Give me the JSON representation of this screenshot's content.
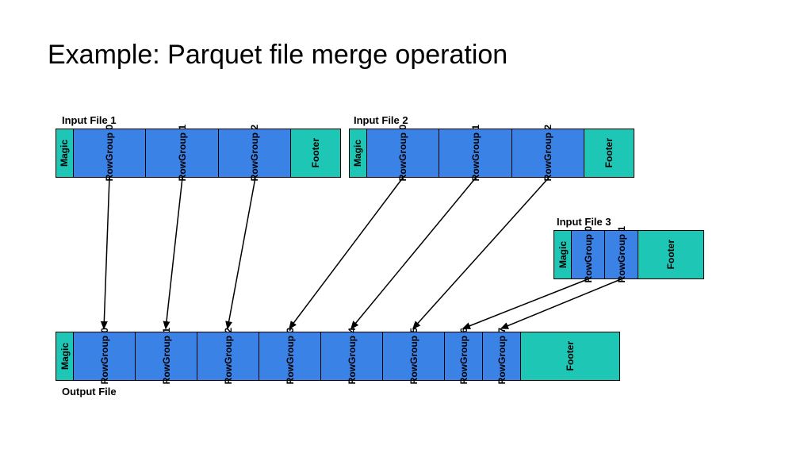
{
  "title": "Example: Parquet file merge operation",
  "labels": {
    "input1": "Input File 1",
    "input2": "Input File 2",
    "input3": "Input File 3",
    "output": "Output File"
  },
  "blocks": {
    "magic": "Magic",
    "footer": "Footer",
    "rg0": "RowGroup 0",
    "rg1": "RowGroup 1",
    "rg2": "RowGroup 2",
    "rg3": "RowGroup 3",
    "rg4": "RowGroup 4",
    "rg5": "RowGroup 5",
    "rg6": "RowGroup 6",
    "rg7": "RowGroup 7"
  },
  "colors": {
    "teal": "#1EC6B6",
    "blue": "#3B82E6"
  },
  "mapping": {
    "description": "RowGroups from input files are concatenated into output file in order: Input1[0,1,2] -> Output[0,1,2], Input2[0,1,2] -> Output[3,4,5], Input3[0,1] -> Output[6,7]"
  }
}
